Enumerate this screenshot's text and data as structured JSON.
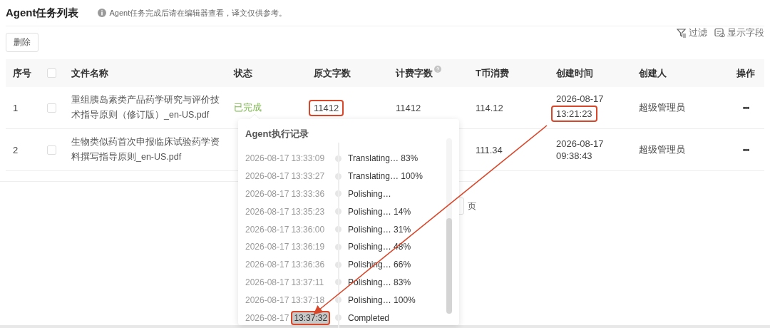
{
  "header": {
    "title": "Agent任务列表",
    "hint": "Agent任务完成后请在编辑器查看，译文仅供参考。"
  },
  "toolbar": {
    "delete_button": "删除",
    "filter": "过滤",
    "fields": "显示字段"
  },
  "table": {
    "columns": [
      "序号",
      "文件名称",
      "状态",
      "原文字数",
      "计费字数",
      "T币消费",
      "创建时间",
      "创建人",
      "操作"
    ],
    "header_checked": false,
    "rows": [
      {
        "index": "1",
        "checked": false,
        "file": "重组胰岛素类产品药学研究与评价技术指导原则（修订版）_en-US.pdf",
        "status": {
          "text": "已完成",
          "kind": "done"
        },
        "source_chars": {
          "text": "11412",
          "highlight": true
        },
        "billed_chars": "11412",
        "cost": "114.12",
        "created_date": "2026-08-17",
        "created_time": {
          "text": "13:21:23",
          "highlight": true
        },
        "creator": "超级管理员",
        "action": "•••"
      },
      {
        "index": "2",
        "checked": false,
        "file": "生物类似药首次申报临床试验药学资料撰写指导原则_en-US.pdf",
        "cost": "111.34",
        "created_date": "2026-08-17",
        "created_time": {
          "text": "09:38:43",
          "highlight": false
        },
        "creator": "超级管理员",
        "action": "•••"
      }
    ]
  },
  "pagination": {
    "page_suffix": "页"
  },
  "popover": {
    "title": "Agent执行记录",
    "entries": [
      {
        "date": "2026-08-17",
        "time": "13:33:09",
        "event": "Translating… 83%",
        "highlight": false
      },
      {
        "date": "2026-08-17",
        "time": "13:33:27",
        "event": "Translating… 100%",
        "highlight": false
      },
      {
        "date": "2026-08-17",
        "time": "13:33:36",
        "event": "Polishing…",
        "highlight": false
      },
      {
        "date": "2026-08-17",
        "time": "13:35:23",
        "event": "Polishing… 14%",
        "highlight": false
      },
      {
        "date": "2026-08-17",
        "time": "13:36:00",
        "event": "Polishing… 31%",
        "highlight": false
      },
      {
        "date": "2026-08-17",
        "time": "13:36:19",
        "event": "Polishing… 48%",
        "highlight": false
      },
      {
        "date": "2026-08-17",
        "time": "13:36:36",
        "event": "Polishing… 66%",
        "highlight": false
      },
      {
        "date": "2026-08-17",
        "time": "13:37:11",
        "event": "Polishing… 83%",
        "highlight": false
      },
      {
        "date": "2026-08-17",
        "time": "13:37:18",
        "event": "Polishing… 100%",
        "highlight": false
      },
      {
        "date": "2026-08-17",
        "time": "13:37:32",
        "event": "Completed",
        "highlight": true
      }
    ]
  }
}
